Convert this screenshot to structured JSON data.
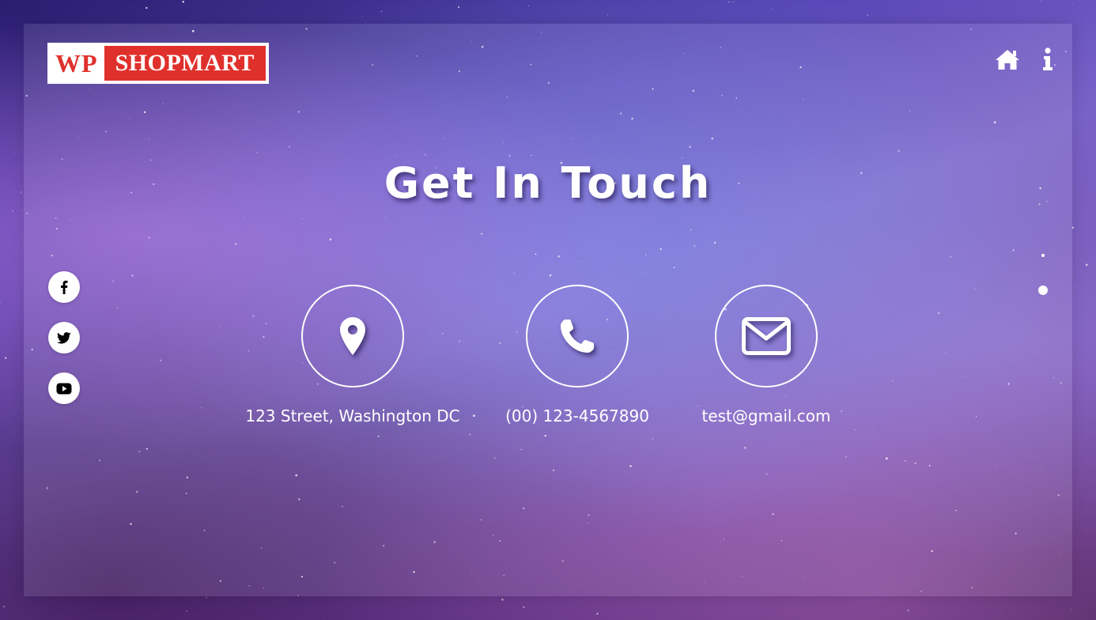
{
  "brand": {
    "logo_prefix": "WP",
    "logo_name": "SHOPMART"
  },
  "header": {
    "icons": [
      "home-icon",
      "info-icon"
    ]
  },
  "hero": {
    "title": "Get In Touch"
  },
  "social": {
    "items": [
      "facebook-icon",
      "twitter-icon",
      "youtube-icon"
    ]
  },
  "contacts": [
    {
      "icon": "map-pin-icon",
      "label": "123 Street, Washington DC"
    },
    {
      "icon": "phone-icon",
      "label": "(00) 123-4567890"
    },
    {
      "icon": "envelope-icon",
      "label": "test@gmail.com"
    }
  ],
  "pagination": {
    "dots": 2,
    "active": 2
  },
  "colors": {
    "brand_red": "#e0302c",
    "text": "#ffffff"
  }
}
